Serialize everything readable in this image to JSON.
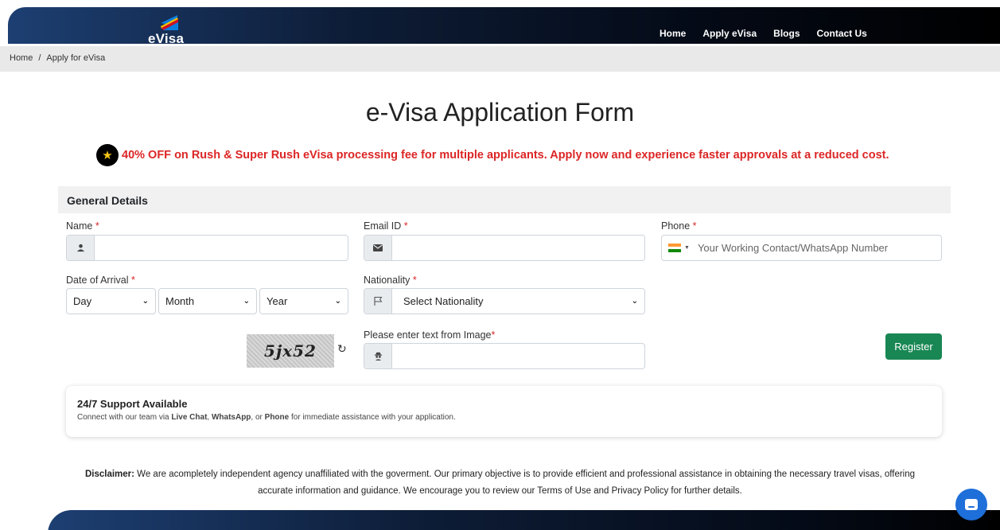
{
  "header": {
    "logo_text": "eVisa",
    "nav": [
      "Home",
      "Apply eVisa",
      "Blogs",
      "Contact Us"
    ]
  },
  "breadcrumb": {
    "home": "Home",
    "separator": "/",
    "current": "Apply for eVisa"
  },
  "title": "e-Visa Application Form",
  "promo": {
    "icon": "star-icon",
    "text": "40% OFF on Rush & Super Rush eVisa processing fee for multiple applicants. Apply now and experience faster approvals at a reduced cost."
  },
  "form": {
    "section_title": "General Details",
    "name": {
      "label": "Name",
      "required_mark": "*",
      "value": "",
      "icon": "user-icon"
    },
    "email": {
      "label": "Email ID",
      "required_mark": "*",
      "value": "",
      "icon": "envelope-icon"
    },
    "phone": {
      "label": "Phone",
      "required_mark": "*",
      "placeholder": "Your Working Contact/WhatsApp Number",
      "country_flag": "india-flag-icon"
    },
    "arrival": {
      "label": "Date of Arrival",
      "required_mark": "*",
      "day": "Day",
      "month": "Month",
      "year": "Year"
    },
    "nationality": {
      "label": "Nationality",
      "required_mark": "*",
      "selected": "Select Nationality",
      "icon": "flag-icon"
    },
    "captcha": {
      "image_text": "5jx52",
      "label": "Please enter text from Image",
      "required_mark": "*",
      "value": "",
      "icon": "user-secret-icon"
    },
    "register_label": "Register"
  },
  "support": {
    "title": "24/7 Support Available",
    "desc_prefix": "Connect with our team via ",
    "live_chat": "Live Chat",
    "comma": ", ",
    "whatsapp": "WhatsApp",
    "or": ", or ",
    "phone": "Phone",
    "desc_suffix": " for immediate assistance with your application."
  },
  "disclaimer": {
    "label": "Disclaimer:",
    "text": " We are acompletely independent agency unaffiliated with the goverment. Our primary objective is to provide efficient and professional assistance in obtaining the necessary travel visas, offering accurate information and guidance. We encourage you to review our Terms of Use and Privacy Policy for further details."
  },
  "colors": {
    "accent_red": "#dc2626",
    "register_green": "#198754",
    "nav_dark": "#040a16",
    "chat_blue": "#1e6fd9"
  }
}
